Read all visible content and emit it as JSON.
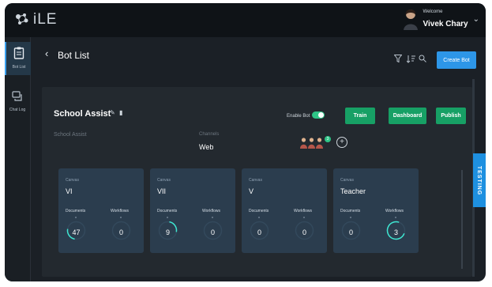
{
  "app": {
    "logo_text": "iLE"
  },
  "user": {
    "welcome": "Welcome",
    "name": "Vivek Chary"
  },
  "sidebar": {
    "items": [
      {
        "label": "Bot List",
        "icon": "clipboard-icon",
        "active": true
      },
      {
        "label": "Chat Log",
        "icon": "chat-icon",
        "active": false
      }
    ]
  },
  "header": {
    "title": "Bot List",
    "create_button": "Create Bot",
    "icons": [
      "filter-icon",
      "sort-icon",
      "search-icon"
    ]
  },
  "bot": {
    "name": "School Assist",
    "subtitle": "School Assist",
    "enable_label": "Enable Bot",
    "enabled": true,
    "buttons": {
      "train": "Train",
      "dashboard": "Dashboard",
      "publish": "Publish"
    },
    "channels_label": "Channels",
    "channels_value": "Web",
    "agents_count": "3"
  },
  "cards": [
    {
      "label": "Canvas",
      "name": "VI",
      "documents_label": "Documents",
      "workflows_label": "Workflows",
      "documents": "47",
      "workflows": "0"
    },
    {
      "label": "Canvas",
      "name": "VII",
      "documents_label": "Documents",
      "workflows_label": "Workflows",
      "documents": "9",
      "workflows": "0"
    },
    {
      "label": "Canvas",
      "name": "V",
      "documents_label": "Documents",
      "workflows_label": "Workflows",
      "documents": "0",
      "workflows": "0"
    },
    {
      "label": "Canvas",
      "name": "Teacher",
      "documents_label": "Documents",
      "workflows_label": "Workflows",
      "documents": "0",
      "workflows": "3"
    }
  ],
  "testing_tab": "TESTING",
  "colors": {
    "accent": "#2d96e8",
    "green": "#17a065",
    "card": "#2b3d4e",
    "ring": "#3ee6d1"
  }
}
